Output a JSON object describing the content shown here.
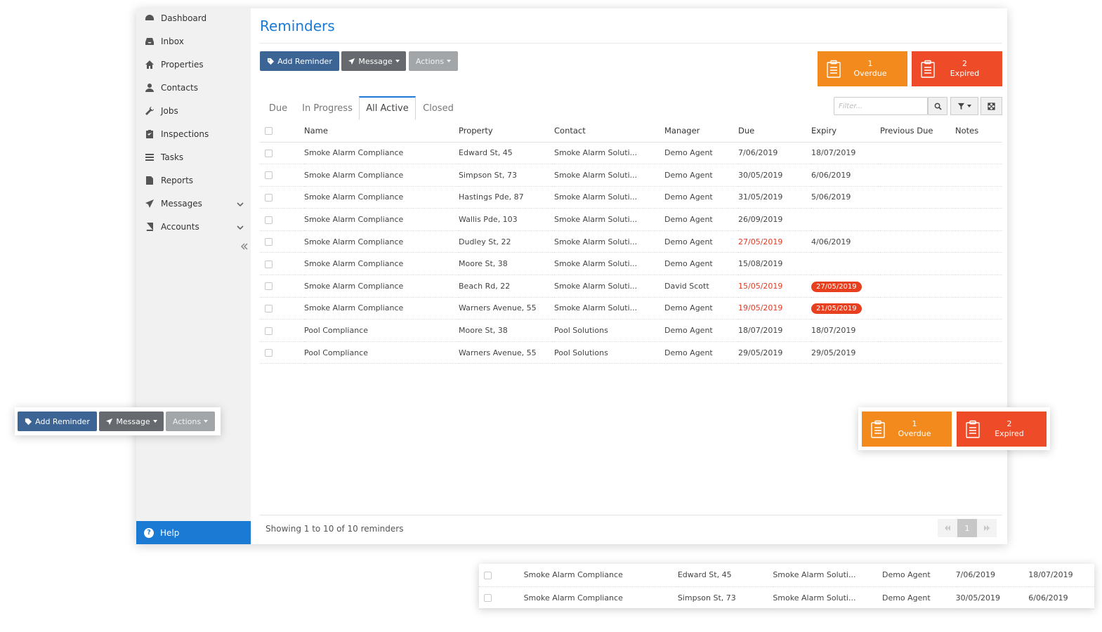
{
  "sidebar": {
    "items": [
      {
        "label": "Dashboard",
        "icon": "dashboard-icon"
      },
      {
        "label": "Inbox",
        "icon": "inbox-icon"
      },
      {
        "label": "Properties",
        "icon": "home-icon"
      },
      {
        "label": "Contacts",
        "icon": "user-icon"
      },
      {
        "label": "Jobs",
        "icon": "wrench-icon"
      },
      {
        "label": "Inspections",
        "icon": "clipboard-check-icon"
      },
      {
        "label": "Tasks",
        "icon": "list-icon"
      },
      {
        "label": "Reports",
        "icon": "document-icon"
      },
      {
        "label": "Messages",
        "icon": "send-icon",
        "expandable": true
      },
      {
        "label": "Accounts",
        "icon": "book-icon",
        "expandable": true
      }
    ],
    "help_label": "Help"
  },
  "page": {
    "title": "Reminders"
  },
  "toolbar": {
    "add_label": "Add Reminder",
    "message_label": "Message",
    "actions_label": "Actions"
  },
  "status": {
    "overdue_count": "1",
    "overdue_label": "Overdue",
    "expired_count": "2",
    "expired_label": "Expired"
  },
  "tabs": [
    {
      "label": "Due",
      "active": false
    },
    {
      "label": "In Progress",
      "active": false
    },
    {
      "label": "All Active",
      "active": true
    },
    {
      "label": "Closed",
      "active": false
    }
  ],
  "filter": {
    "placeholder": "Filter..."
  },
  "table": {
    "columns": [
      "Name",
      "Property",
      "Contact",
      "Manager",
      "Due",
      "Expiry",
      "Previous Due",
      "Notes"
    ],
    "rows": [
      {
        "name": "Smoke Alarm Compliance",
        "property": "Edward St, 45",
        "contact": "Smoke Alarm Soluti...",
        "manager": "Demo Agent",
        "due": "7/06/2019",
        "due_overdue": false,
        "expiry": "18/07/2019",
        "expiry_badge": false,
        "previous_due": "",
        "notes": ""
      },
      {
        "name": "Smoke Alarm Compliance",
        "property": "Simpson St, 73",
        "contact": "Smoke Alarm Soluti...",
        "manager": "Demo Agent",
        "due": "30/05/2019",
        "due_overdue": false,
        "expiry": "6/06/2019",
        "expiry_badge": false,
        "previous_due": "",
        "notes": ""
      },
      {
        "name": "Smoke Alarm Compliance",
        "property": "Hastings Pde, 87",
        "contact": "Smoke Alarm Soluti...",
        "manager": "Demo Agent",
        "due": "31/05/2019",
        "due_overdue": false,
        "expiry": "5/06/2019",
        "expiry_badge": false,
        "previous_due": "",
        "notes": ""
      },
      {
        "name": "Smoke Alarm Compliance",
        "property": "Wallis Pde, 103",
        "contact": "Smoke Alarm Soluti...",
        "manager": "Demo Agent",
        "due": "26/09/2019",
        "due_overdue": false,
        "expiry": "",
        "expiry_badge": false,
        "previous_due": "",
        "notes": ""
      },
      {
        "name": "Smoke Alarm Compliance",
        "property": "Dudley St, 22",
        "contact": "Smoke Alarm Soluti...",
        "manager": "Demo Agent",
        "due": "27/05/2019",
        "due_overdue": true,
        "expiry": "4/06/2019",
        "expiry_badge": false,
        "previous_due": "",
        "notes": ""
      },
      {
        "name": "Smoke Alarm Compliance",
        "property": "Moore St, 38",
        "contact": "Smoke Alarm Soluti...",
        "manager": "Demo Agent",
        "due": "15/08/2019",
        "due_overdue": false,
        "expiry": "",
        "expiry_badge": false,
        "previous_due": "",
        "notes": ""
      },
      {
        "name": "Smoke Alarm Compliance",
        "property": "Beach Rd, 22",
        "contact": "Smoke Alarm Soluti...",
        "manager": "David Scott",
        "due": "15/05/2019",
        "due_overdue": true,
        "expiry": "27/05/2019",
        "expiry_badge": true,
        "previous_due": "",
        "notes": ""
      },
      {
        "name": "Smoke Alarm Compliance",
        "property": "Warners Avenue, 55",
        "contact": "Smoke Alarm Soluti...",
        "manager": "Demo Agent",
        "due": "19/05/2019",
        "due_overdue": true,
        "expiry": "21/05/2019",
        "expiry_badge": true,
        "previous_due": "",
        "notes": ""
      },
      {
        "name": "Pool Compliance",
        "property": "Moore St, 38",
        "contact": "Pool Solutions",
        "manager": "Demo Agent",
        "due": "18/07/2019",
        "due_overdue": false,
        "expiry": "18/07/2019",
        "expiry_badge": false,
        "previous_due": "",
        "notes": ""
      },
      {
        "name": "Pool Compliance",
        "property": "Warners Avenue, 55",
        "contact": "Pool Solutions",
        "manager": "Demo Agent",
        "due": "29/05/2019",
        "due_overdue": false,
        "expiry": "29/05/2019",
        "expiry_badge": false,
        "previous_due": "",
        "notes": ""
      }
    ]
  },
  "footer": {
    "showing_text": "Showing 1 to 10 of 10 reminders",
    "current_page": "1"
  },
  "colors": {
    "accent": "#1a7ad4",
    "primary_button": "#3c6595",
    "overdue": "#f28a1e",
    "expired": "#ee4b28",
    "danger_text": "#e23a20"
  }
}
